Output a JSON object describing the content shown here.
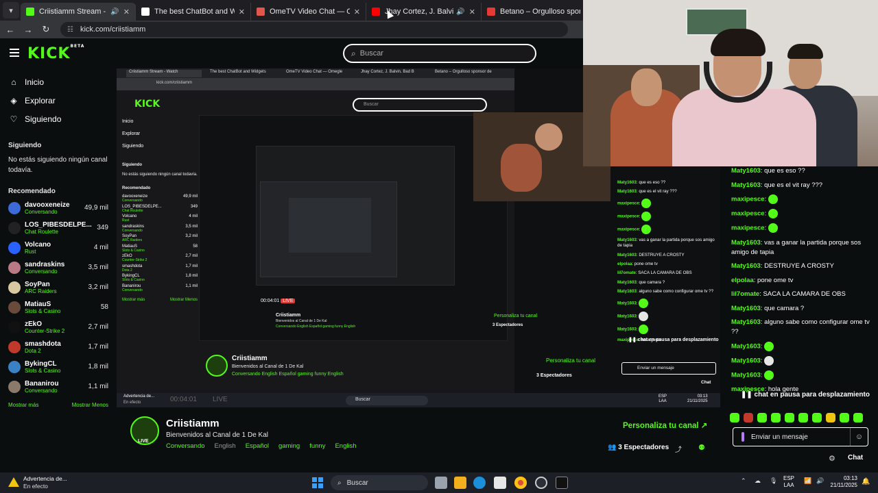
{
  "browser": {
    "tabs": [
      {
        "title": "Criistiamm Stream - Watch",
        "color": "#53fc18",
        "active": true,
        "audio": true
      },
      {
        "title": "The best ChatBot and Widgets",
        "color": "#ffffff",
        "active": false
      },
      {
        "title": "OmeTV Video Chat — Omegle",
        "color": "#e2574c",
        "active": false
      },
      {
        "title": "Jhay Cortez, J. Balvin, Bad B",
        "color": "#ff0000",
        "active": false,
        "audio": true
      },
      {
        "title": "Betano – Orgulloso sponsor de",
        "color": "#e53935",
        "active": false
      }
    ],
    "new_tab": "+",
    "url": "kick.com/criistiamm"
  },
  "header": {
    "logo": "KICK",
    "logo_badge": "BETA",
    "search_placeholder": "Buscar"
  },
  "sidebar": {
    "nav": [
      {
        "label": "Inicio",
        "icon": "home-icon"
      },
      {
        "label": "Explorar",
        "icon": "compass-icon"
      },
      {
        "label": "Siguiendo",
        "icon": "heart-icon"
      }
    ],
    "following_title": "Siguiendo",
    "following_empty": "No estás siguiendo ningún canal todavía.",
    "recommended_title": "Recomendado",
    "recommended": [
      {
        "name": "davooxeneize",
        "category": "Conversando",
        "viewers": "49,9 mil",
        "color": "#3c6ad6"
      },
      {
        "name": "LOS_PIBESDELPE...",
        "category": "Chat Roulette",
        "viewers": "349",
        "color": "#222222"
      },
      {
        "name": "Volcano",
        "category": "Rust",
        "viewers": "4 mil",
        "color": "#2962ff"
      },
      {
        "name": "sandraskins",
        "category": "Conversando",
        "viewers": "3,5 mil",
        "color": "#b97a86"
      },
      {
        "name": "SoyPan",
        "category": "ARC Raiders",
        "viewers": "3,2 mil",
        "color": "#d9c9a3"
      },
      {
        "name": "MatiauS",
        "category": "Slots & Casino",
        "viewers": "58",
        "color": "#6a4a3a"
      },
      {
        "name": "zEkO",
        "category": "Counter-Strike 2",
        "viewers": "2,7 mil",
        "color": "#111111"
      },
      {
        "name": "smashdota",
        "category": "Dota 2",
        "viewers": "1,7 mil",
        "color": "#c0392b"
      },
      {
        "name": "BykingCL",
        "category": "Slots & Casino",
        "viewers": "1,8 mil",
        "color": "#3b82c4"
      },
      {
        "name": "Bananirou",
        "category": "Conversando",
        "viewers": "1,1 mil",
        "color": "#8a7a6a"
      }
    ],
    "show_more": "Mostrar más",
    "show_less": "Mostrar Menos"
  },
  "channel": {
    "name": "Criistiamm",
    "live_badge": "LIVE",
    "welcome": "Bienvenidos al Canal de 1 De Kal",
    "tags": [
      {
        "label": "Conversando",
        "style": "green"
      },
      {
        "label": "English",
        "style": "grey"
      },
      {
        "label": "Español",
        "style": "green"
      },
      {
        "label": "gaming",
        "style": "green"
      },
      {
        "label": "funny",
        "style": "green"
      },
      {
        "label": "English",
        "style": "green"
      }
    ],
    "personalize": "Personaliza tu canal",
    "viewers": "3 Espectadores"
  },
  "chat": {
    "messages": [
      {
        "user": "Maty1603",
        "text": "que es eso ??"
      },
      {
        "user": "Maty1603",
        "text": "que es el vit ray ???"
      },
      {
        "user": "maxipesce",
        "text": "",
        "emote": "green"
      },
      {
        "user": "maxipesce",
        "text": "",
        "emote": "green"
      },
      {
        "user": "maxipesce",
        "text": "",
        "emote": "green"
      },
      {
        "user": "Maty1603",
        "text": "vas a ganar la partida porque sos amigo de tapia"
      },
      {
        "user": "Maty1603",
        "text": "DESTRUYE A CROSTY"
      },
      {
        "user": "elpolaa",
        "text": "pone ome tv"
      },
      {
        "user": "lil7omate",
        "text": "SACA LA CAMARA DE OBS"
      },
      {
        "user": "Maty1603",
        "text": "que camara ?"
      },
      {
        "user": "Maty1603",
        "text": "alguno sabe como configurar ome tv ??"
      },
      {
        "user": "Maty1603",
        "text": "",
        "emote": "green"
      },
      {
        "user": "Maty1603",
        "text": "",
        "emote": "skull"
      },
      {
        "user": "Maty1603",
        "text": "",
        "emote": "green"
      },
      {
        "user": "maxipesce",
        "text": "hola gente"
      }
    ],
    "paused": "chat en pausa para desplazamiento",
    "input_placeholder": "Enviar un mensaje",
    "chat_button": "Chat"
  },
  "nested": {
    "url": "kick.com/criistiamm",
    "search": "Buscar",
    "nav": [
      "Inicio",
      "Explorar",
      "Siguiendo"
    ],
    "following_title": "Siguiendo",
    "following_empty": "No estás siguiendo ningún canal todavía.",
    "recommended_title": "Recomendado",
    "recommended": [
      {
        "name": "davooxeneize",
        "category": "Conversando",
        "viewers": "49,9 mil"
      },
      {
        "name": "LOS_PIBESDELPE...",
        "category": "Chat Roulette",
        "viewers": "349"
      },
      {
        "name": "Volcano",
        "category": "Rust",
        "viewers": "4 mil"
      },
      {
        "name": "sandraskins",
        "category": "Conversando",
        "viewers": "3,5 mil"
      },
      {
        "name": "SoyPan",
        "category": "ARC Raiders",
        "viewers": "3,2 mil"
      },
      {
        "name": "MatiauS",
        "category": "Slots & Casino",
        "viewers": "58"
      },
      {
        "name": "zEkO",
        "category": "Counter-Strike 2",
        "viewers": "2,7 mil"
      },
      {
        "name": "smashdota",
        "category": "Dota 2",
        "viewers": "1,7 mil"
      },
      {
        "name": "BykingCL",
        "category": "Slots & Casino",
        "viewers": "1,8 mil"
      },
      {
        "name": "Bananirou",
        "category": "Conversando",
        "viewers": "1,1 mil"
      }
    ],
    "show_more": "Mostrar más",
    "show_less": "Mostrar Menos",
    "channel_name": "Criistiamm",
    "channel_welcome": "Bienvenidos al Canal de 1 De Kal",
    "channel_tags": "Conversando   English   Español   gaming   funny   English",
    "personalize": "Personaliza tu canal",
    "viewers": "3 Espectadores",
    "chat": [
      {
        "user": "Maty1603",
        "text": "que es eso ??"
      },
      {
        "user": "Maty1603",
        "text": "que es el vit ray ???"
      },
      {
        "user": "maxipesce",
        "text": "",
        "emote": "green"
      },
      {
        "user": "maxipesce",
        "text": "",
        "emote": "green"
      },
      {
        "user": "maxipesce",
        "text": "",
        "emote": "green"
      },
      {
        "user": "Maty1603",
        "text": "vas a ganar la partida porque sos amigo de tapia"
      },
      {
        "user": "Maty1603",
        "text": "DESTRUYE A CROSTY"
      },
      {
        "user": "elpolaa",
        "text": "pone ome tv"
      },
      {
        "user": "lil7omate",
        "text": "SACA LA CAMARA DE OBS"
      },
      {
        "user": "Maty1603",
        "text": "que camara ?"
      },
      {
        "user": "Maty1603",
        "text": "alguno sabe como configurar ome tv ??"
      },
      {
        "user": "Maty1603",
        "text": "",
        "emote": "green"
      },
      {
        "user": "Maty1603",
        "text": "",
        "emote": "skull"
      },
      {
        "user": "Maty1603",
        "text": "",
        "emote": "green"
      },
      {
        "user": "maxipesce",
        "text": "hola gente"
      }
    ],
    "chat_paused": "chat en pausa para desplazamiento",
    "chat_input": "Enviar un mensaje",
    "chat_button": "Chat",
    "player_time": "00:04:01",
    "player_live": "LIVE",
    "taskbar_search": "Buscar",
    "warning_title": "Advertencia de...",
    "warning_sub": "En efecto",
    "tray_lang": "ESP",
    "tray_layout": "LAA",
    "tray_time": "03:13",
    "tray_date": "21/11/2025"
  },
  "taskbar": {
    "warning_title": "Advertencia de...",
    "warning_sub": "En efecto",
    "search": "Buscar",
    "lang": "ESP",
    "layout": "LAA",
    "time": "03:13",
    "date": "21/11/2025"
  },
  "colors": {
    "kick_green": "#53fc18",
    "background": "#0b0e0f"
  }
}
